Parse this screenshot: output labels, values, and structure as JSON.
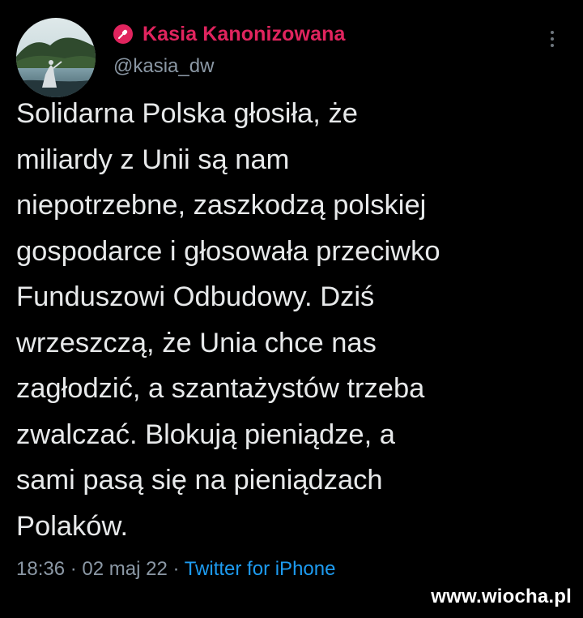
{
  "author": {
    "display_name": "Kasia Kanonizowana",
    "handle": "@kasia_dw",
    "avatar_icon": "landscape-avatar-icon",
    "badge_icon": "microphone-icon",
    "name_color": "#e0245e"
  },
  "tweet": {
    "lines": [
      "Solidarna Polska głosiła, że",
      "miliardy z Unii są nam",
      "niepotrzebne, zaszkodzą polskiej",
      "gospodarce i głosowała przeciwko",
      "Funduszowi Odbudowy. Dziś",
      "wrzeszczą, że Unia chce nas",
      "zagłodzić, a szantażystów trzeba",
      "zwalczać. Blokują pieniądze, a",
      "sami pasą się na pieniądzach",
      "Polaków."
    ]
  },
  "meta": {
    "time": "18:36",
    "separator": " · ",
    "date": "02 maj 22",
    "source": "Twitter for iPhone",
    "source_color": "#1d9bf0"
  },
  "menu": {
    "icon": "more-options-icon"
  },
  "watermark": "www.wiocha.pl"
}
